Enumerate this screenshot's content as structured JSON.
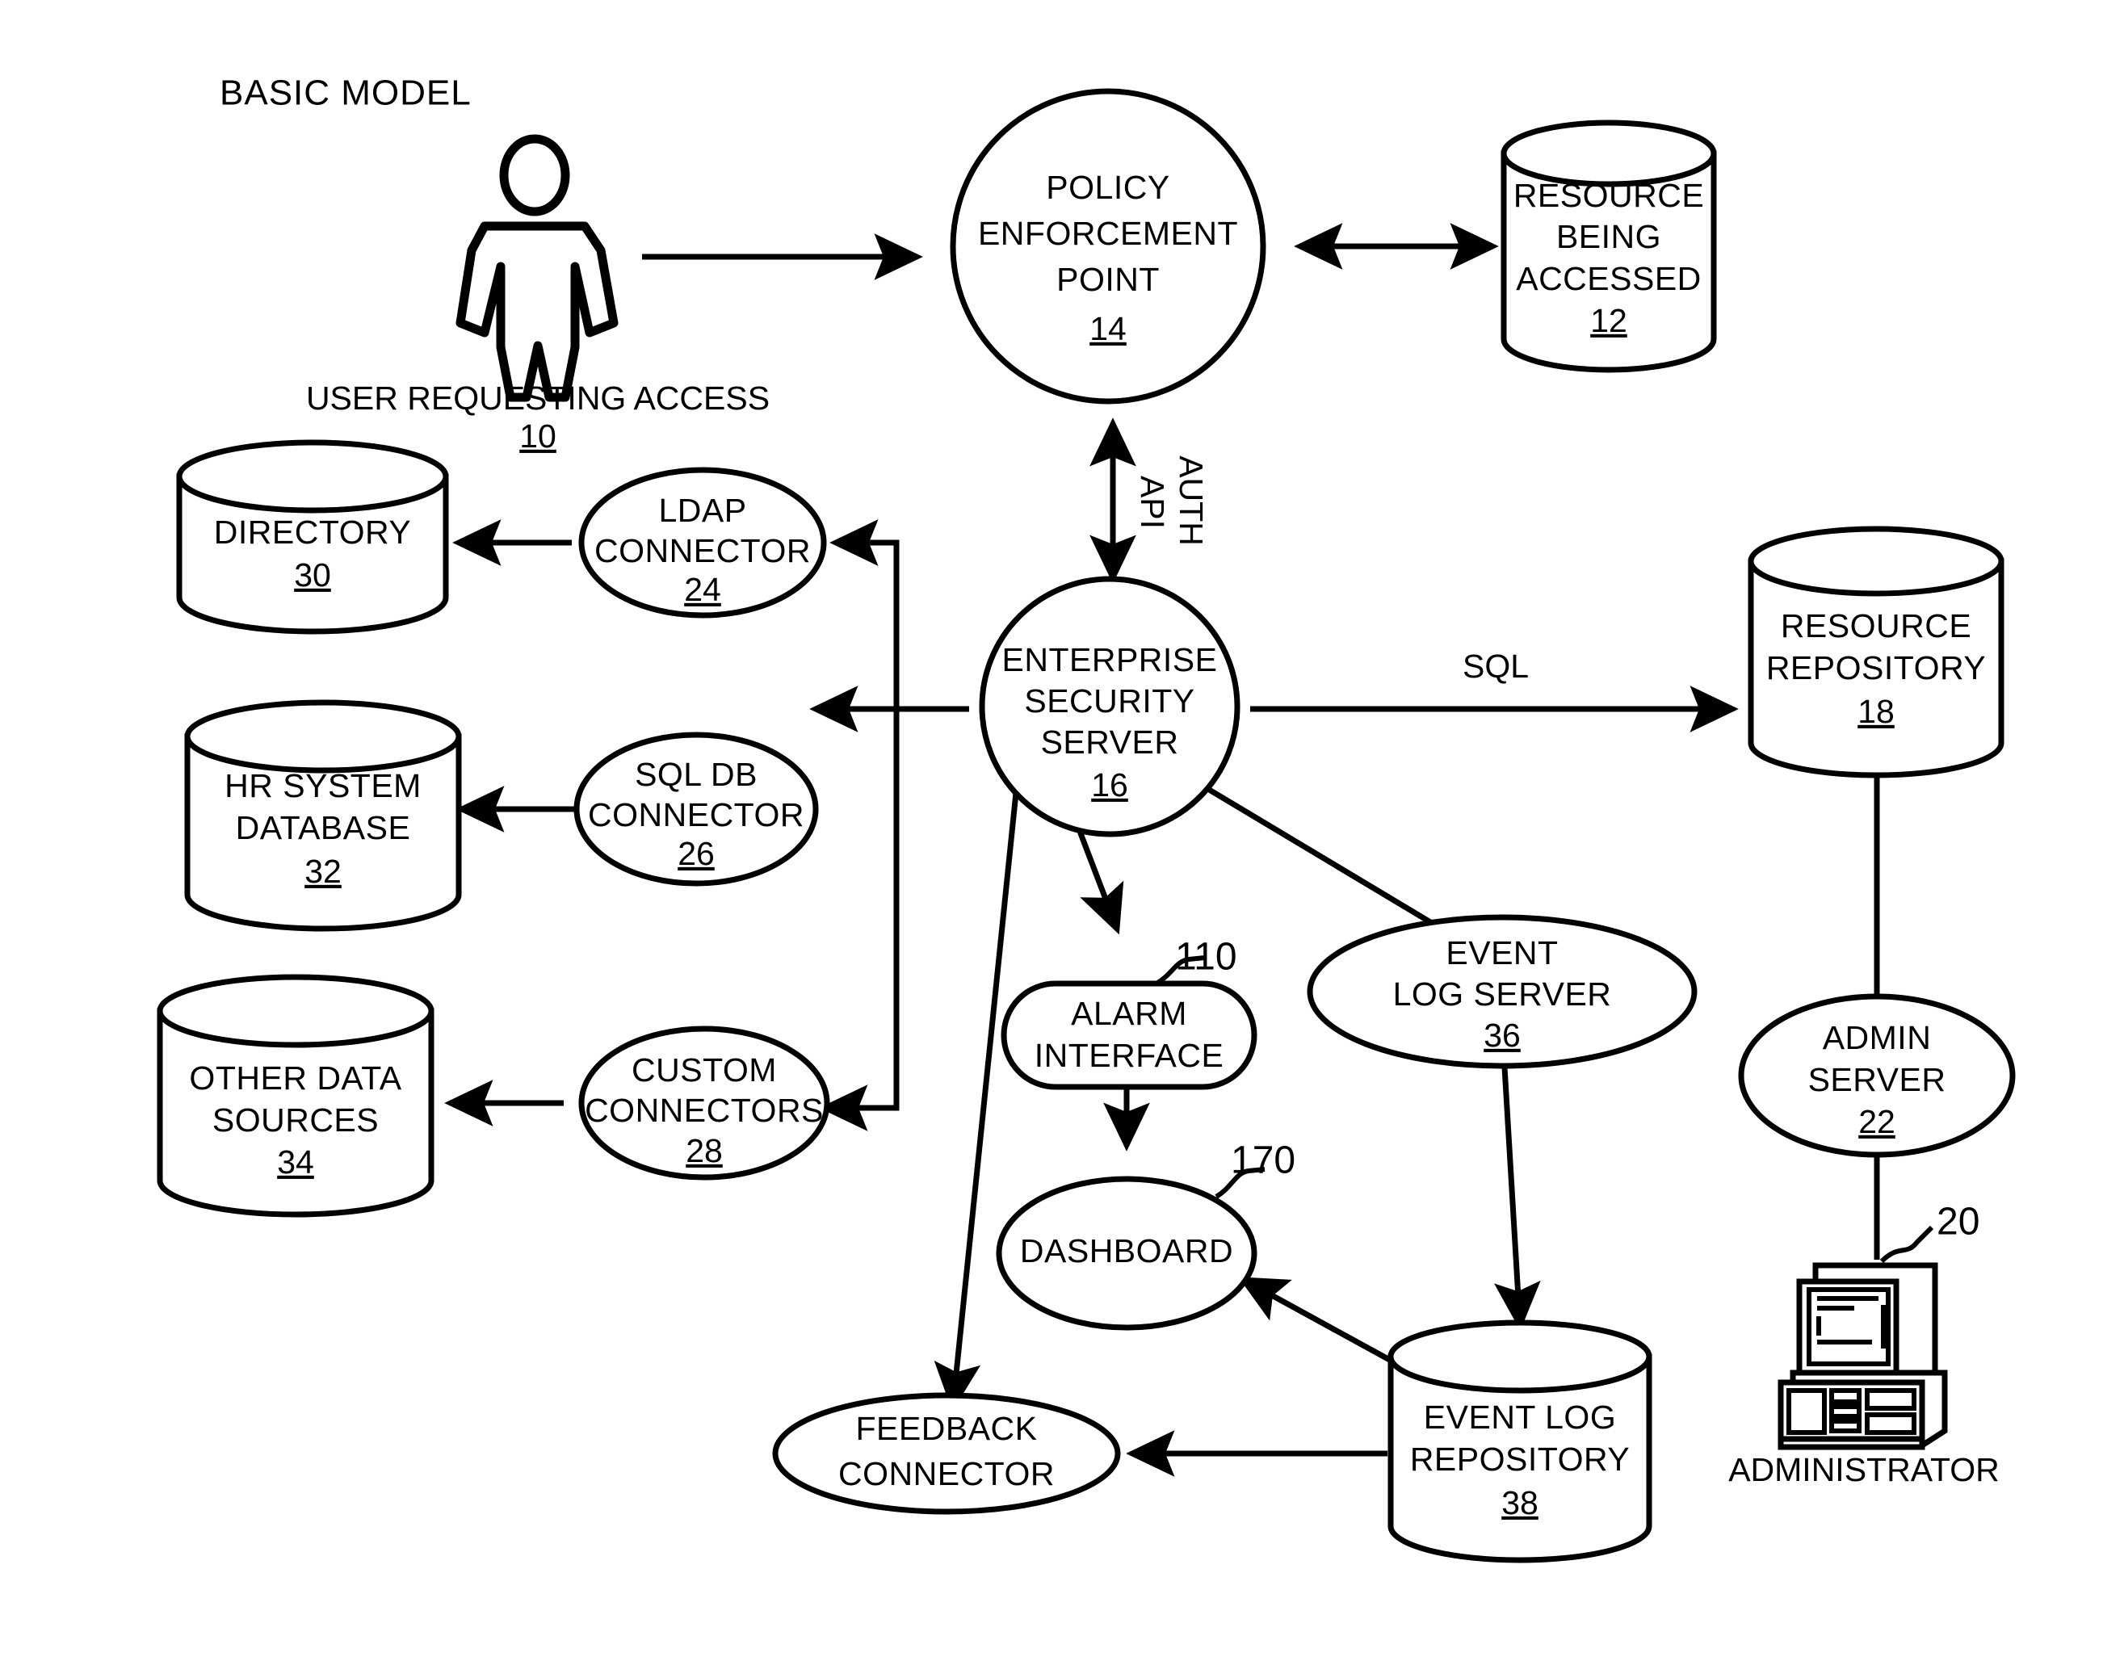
{
  "figure": {
    "title": "BASIC MODEL",
    "background_color": "#ffffff",
    "ink_color": "#000000"
  },
  "nodes": {
    "user": {
      "shape": "person",
      "caption": "USER REQUESTING ACCESS",
      "ref": "10"
    },
    "policy_enforcement_point": {
      "shape": "circle",
      "line1": "POLICY",
      "line2": "ENFORCEMENT",
      "line3": "POINT",
      "ref": "14"
    },
    "resource_being_accessed": {
      "shape": "cylinder",
      "line1": "RESOURCE",
      "line2": "BEING",
      "line3": "ACCESSED",
      "ref": "12"
    },
    "enterprise_security_server": {
      "shape": "circle",
      "line1": "ENTERPRISE",
      "line2": "SECURITY",
      "line3": "SERVER",
      "ref": "16"
    },
    "directory": {
      "shape": "cylinder",
      "line1": "DIRECTORY",
      "ref": "30"
    },
    "ldap_connector": {
      "shape": "ellipse",
      "line1": "LDAP",
      "line2": "CONNECTOR",
      "ref": "24"
    },
    "hr_system_database": {
      "shape": "cylinder",
      "line1": "HR SYSTEM",
      "line2": "DATABASE",
      "ref": "32"
    },
    "sql_db_connector": {
      "shape": "ellipse",
      "line1": "SQL DB",
      "line2": "CONNECTOR",
      "ref": "26"
    },
    "other_data_sources": {
      "shape": "cylinder",
      "line1": "OTHER DATA",
      "line2": "SOURCES",
      "ref": "34"
    },
    "custom_connectors": {
      "shape": "ellipse",
      "line1": "CUSTOM",
      "line2": "CONNECTORS",
      "ref": "28"
    },
    "resource_repository": {
      "shape": "cylinder",
      "line1": "RESOURCE",
      "line2": "REPOSITORY",
      "ref": "18"
    },
    "admin_server": {
      "shape": "ellipse",
      "line1": "ADMIN",
      "line2": "SERVER",
      "ref": "22"
    },
    "administrator": {
      "shape": "computer",
      "caption": "ADMINISTRATOR",
      "ref": "20"
    },
    "alarm_interface": {
      "shape": "stadium",
      "line1": "ALARM",
      "line2": "INTERFACE",
      "ref": "110"
    },
    "dashboard": {
      "shape": "ellipse",
      "line1": "DASHBOARD",
      "ref": "170"
    },
    "event_log_server": {
      "shape": "ellipse",
      "line1": "EVENT",
      "line2": "LOG SERVER",
      "ref": "36"
    },
    "event_log_repository": {
      "shape": "cylinder",
      "line1": "EVENT LOG",
      "line2": "REPOSITORY",
      "ref": "38"
    },
    "feedback_connector": {
      "shape": "ellipse",
      "line1": "FEEDBACK",
      "line2": "CONNECTOR"
    }
  },
  "edge_labels": {
    "auth_api_line1": "AUTH",
    "auth_api_line2": "API",
    "sql": "SQL"
  }
}
